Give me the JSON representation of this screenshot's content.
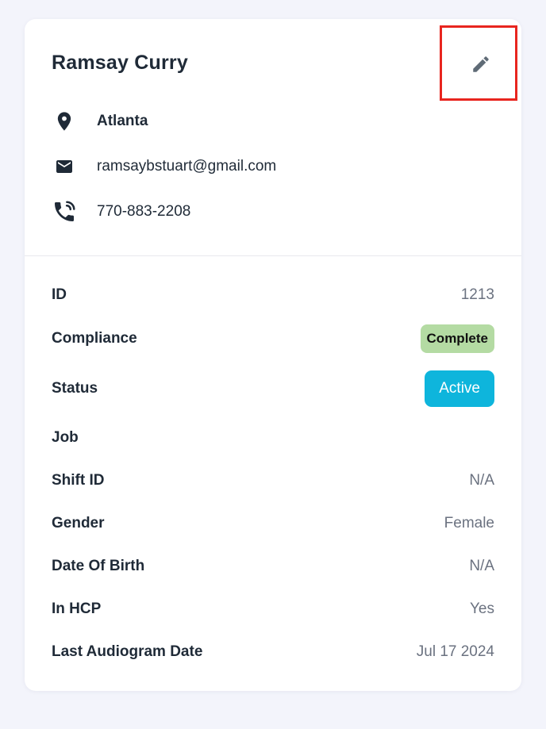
{
  "profile": {
    "name": "Ramsay Curry",
    "location": "Atlanta",
    "email": "ramsaybstuart@gmail.com",
    "phone": "770-883-2208"
  },
  "icons": {
    "edit": "pencil-icon",
    "location": "location-pin-icon",
    "email": "envelope-icon",
    "phone": "phone-icon"
  },
  "details": {
    "id_label": "ID",
    "id_value": "1213",
    "compliance_label": "Compliance",
    "compliance_value": "Complete",
    "status_label": "Status",
    "status_value": "Active",
    "job_label": "Job",
    "job_value": "",
    "shift_label": "Shift ID",
    "shift_value": "N/A",
    "gender_label": "Gender",
    "gender_value": "Female",
    "dob_label": "Date Of Birth",
    "dob_value": "N/A",
    "hcp_label": "In HCP",
    "hcp_value": "Yes",
    "audiogram_label": "Last Audiogram Date",
    "audiogram_value": "Jul 17 2024"
  },
  "colors": {
    "page_background": "#f3f4fb",
    "complete_badge": "#b4dba3",
    "active_badge": "#0eb5dc",
    "highlight_border": "#e8251f"
  }
}
